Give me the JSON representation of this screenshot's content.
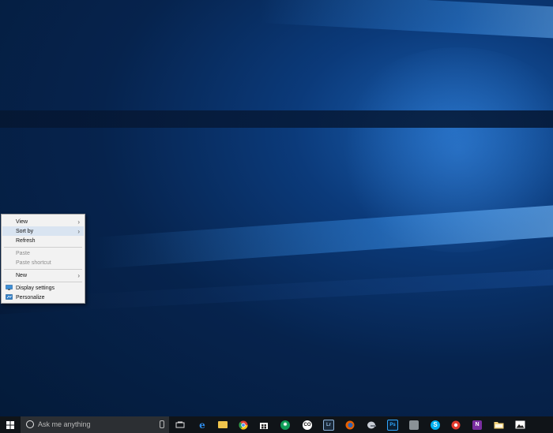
{
  "context_menu": {
    "items": [
      {
        "label": "View",
        "has_submenu": true,
        "enabled": true
      },
      {
        "label": "Sort by",
        "has_submenu": true,
        "enabled": true,
        "highlighted": true
      },
      {
        "label": "Refresh",
        "has_submenu": false,
        "enabled": true
      },
      {
        "label": "Paste",
        "has_submenu": false,
        "enabled": false
      },
      {
        "label": "Paste shortcut",
        "has_submenu": false,
        "enabled": false
      },
      {
        "label": "New",
        "has_submenu": true,
        "enabled": true
      },
      {
        "label": "Display settings",
        "icon": "display-settings-icon",
        "enabled": true
      },
      {
        "label": "Personalize",
        "icon": "personalize-icon",
        "enabled": true
      }
    ]
  },
  "taskbar": {
    "search_placeholder": "Ask me anything",
    "pinned": [
      {
        "name": "task-view-icon"
      },
      {
        "name": "edge-icon"
      },
      {
        "name": "file-explorer-icon"
      },
      {
        "name": "chrome-icon"
      },
      {
        "name": "store-icon"
      },
      {
        "name": "green-app-icon"
      },
      {
        "name": "co-app-icon"
      },
      {
        "name": "lightroom-icon"
      },
      {
        "name": "firefox-icon"
      },
      {
        "name": "helmet-app-icon"
      },
      {
        "name": "photoshop-icon"
      },
      {
        "name": "gray-app-icon"
      },
      {
        "name": "skype-icon"
      },
      {
        "name": "red-app-icon"
      },
      {
        "name": "onenote-icon"
      },
      {
        "name": "folder-app-icon"
      },
      {
        "name": "photos-icon"
      }
    ]
  },
  "colors": {
    "taskbar_bg": "#101418",
    "menu_bg": "#f2f2f2",
    "highlight": "#d9e4f1",
    "accent": "#1a5fb0"
  }
}
